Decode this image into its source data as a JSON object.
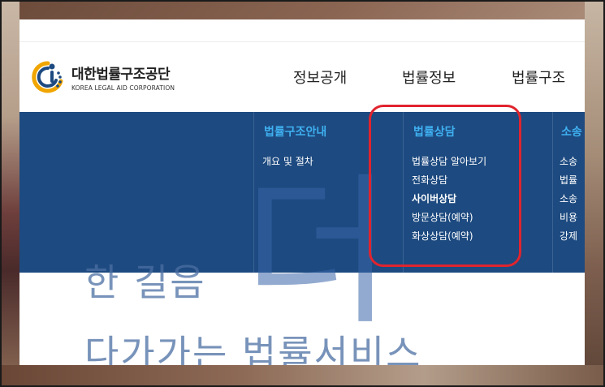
{
  "logo": {
    "name_ko": "대한법률구조공단",
    "name_en": "KOREA LEGAL AID CORPORATION"
  },
  "gnb": {
    "items": [
      "정보공개",
      "법률정보",
      "법률구조"
    ]
  },
  "megamenu": {
    "columns": [
      {
        "title": "법률구조안내",
        "items": [
          "개요 및 절차"
        ]
      },
      {
        "title": "법률상담",
        "items": [
          "법률상담 알아보기",
          "전화상담",
          "사이버상담",
          "방문상담(예약)",
          "화상상담(예약)"
        ]
      },
      {
        "title": "소송",
        "items": [
          "소송",
          "법률",
          "소송",
          "비용",
          "강제"
        ]
      }
    ]
  },
  "hero": {
    "big_char": "더",
    "line1": "한 길음",
    "line2": "다가가는 법률서비스"
  },
  "colors": {
    "megamenu_bg": "#1d4a80",
    "menu_title": "#3fb0f0",
    "highlight": "#e0242e"
  }
}
